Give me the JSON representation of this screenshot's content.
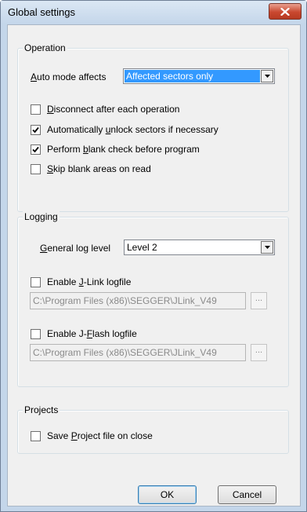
{
  "window": {
    "title": "Global settings"
  },
  "operation": {
    "label": "Operation",
    "auto_mode_label_pre": "",
    "auto_mode_label_key": "A",
    "auto_mode_label_post": "uto mode affects",
    "auto_mode_value": "Affected sectors only",
    "checkboxes": [
      {
        "pre": "",
        "key": "D",
        "post": "isconnect after each operation",
        "checked": false
      },
      {
        "pre": "Automatically ",
        "key": "u",
        "post": "nlock sectors if necessary",
        "checked": true
      },
      {
        "pre": "Perform ",
        "key": "b",
        "post": "lank check before program",
        "checked": true
      },
      {
        "pre": "",
        "key": "S",
        "post": "kip blank areas on read",
        "checked": false
      }
    ]
  },
  "logging": {
    "label": "Logging",
    "log_level_label_pre": "",
    "log_level_label_key": "G",
    "log_level_label_post": "eneral log level",
    "log_level_value": "Level 2",
    "jlink": {
      "pre": "Enable ",
      "key": "J",
      "post": "-Link logfile",
      "checked": false,
      "path": "C:\\Program Files (x86)\\SEGGER\\JLink_V49",
      "browse": "..."
    },
    "jflash": {
      "pre": "Enable J-",
      "key": "F",
      "post": "lash logfile",
      "checked": false,
      "path": "C:\\Program Files (x86)\\SEGGER\\JLink_V49",
      "browse": "..."
    }
  },
  "projects": {
    "label": "Projects",
    "save_pre": "Save ",
    "save_key": "P",
    "save_post": "roject file on close",
    "checked": false
  },
  "buttons": {
    "ok": "OK",
    "cancel": "Cancel"
  }
}
